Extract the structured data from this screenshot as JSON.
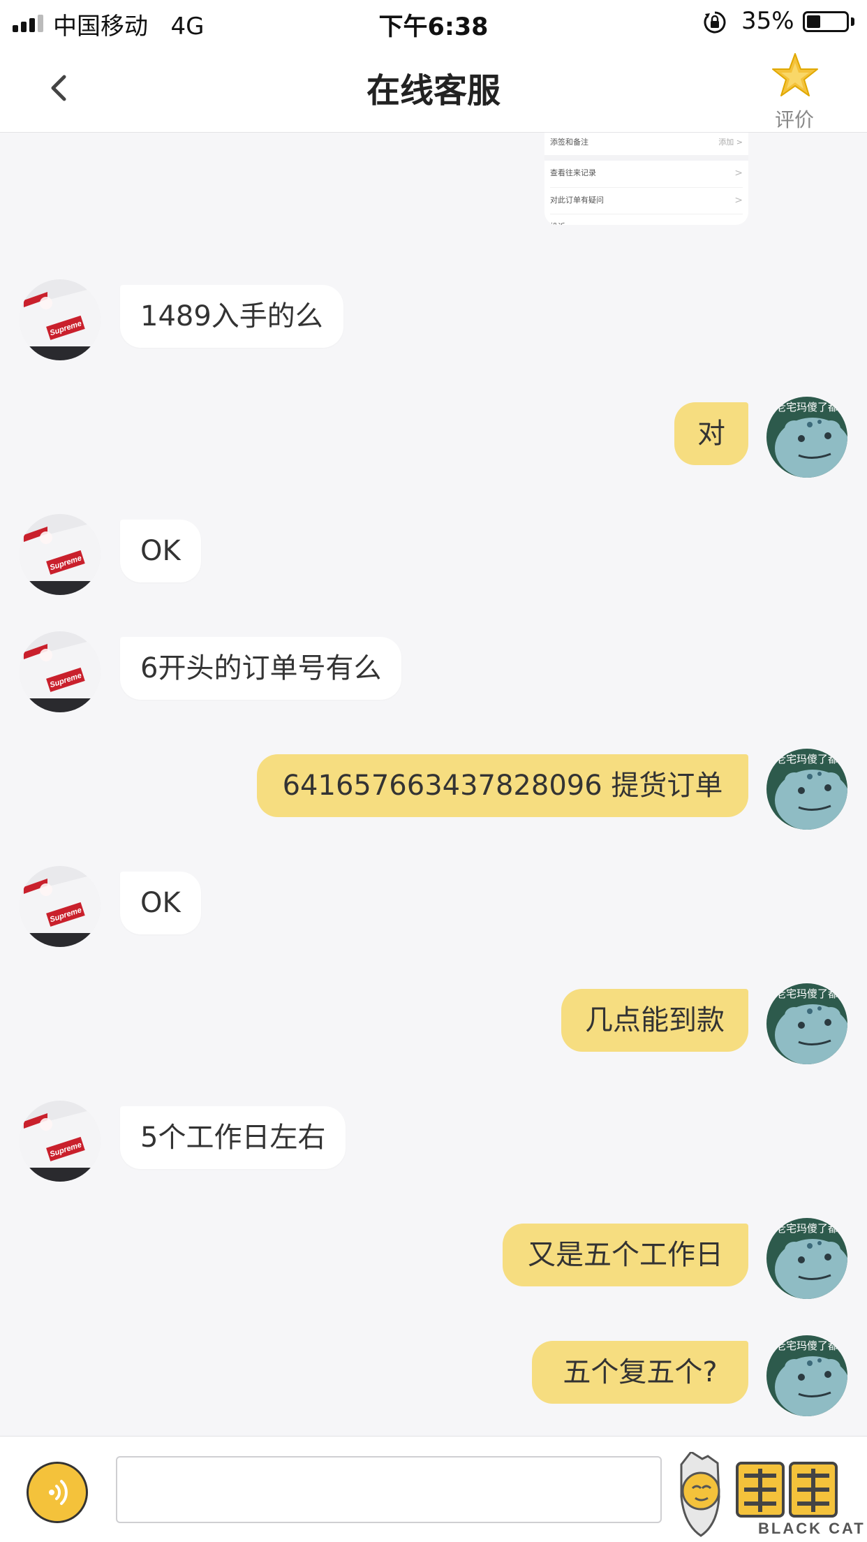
{
  "status_bar": {
    "carrier": "中国移动",
    "network": "4G",
    "time": "下午6:38",
    "battery_percent_text": "35%",
    "battery_level": 0.35,
    "icons": [
      "signal-icon",
      "orientation-lock-icon",
      "battery-icon"
    ]
  },
  "nav": {
    "title": "在线客服",
    "rate_label": "评价",
    "back_icon": "chevron-left-icon",
    "rate_icon": "star-icon",
    "accent": "#f4c23b"
  },
  "screenshot_preview": {
    "rows": [
      {
        "label": "添签和备注",
        "right": "添加 >"
      },
      {
        "label": "查看往来记录",
        "right": ">"
      },
      {
        "label": "对此订单有疑问",
        "right": ">"
      },
      {
        "label": "投诉",
        "right": ""
      }
    ]
  },
  "messages": [
    {
      "from": "agent",
      "text": "1489入手的么"
    },
    {
      "from": "user",
      "text": "对"
    },
    {
      "from": "agent",
      "text": "OK"
    },
    {
      "from": "agent",
      "text": "6开头的订单号有么"
    },
    {
      "from": "user",
      "text": "641657663437828096 提货订单"
    },
    {
      "from": "agent",
      "text": "OK"
    },
    {
      "from": "user",
      "text": "几点能到款"
    },
    {
      "from": "agent",
      "text": "5个工作日左右"
    },
    {
      "from": "user",
      "text": "又是五个工作日"
    },
    {
      "from": "user",
      "text": "五个复五个?"
    }
  ],
  "avatars": {
    "agent_sign_text": "Supreme",
    "user_caption": "老宅玛傻了都"
  },
  "colors": {
    "user_bubble": "#f6dd80",
    "agent_bubble": "#ffffff",
    "background": "#f6f6f8"
  },
  "input_bar": {
    "placeholder": "",
    "voice_icon": "voice-icon",
    "watermark_text": "BLACK CAT",
    "watermark_glyph": "黑猫"
  }
}
